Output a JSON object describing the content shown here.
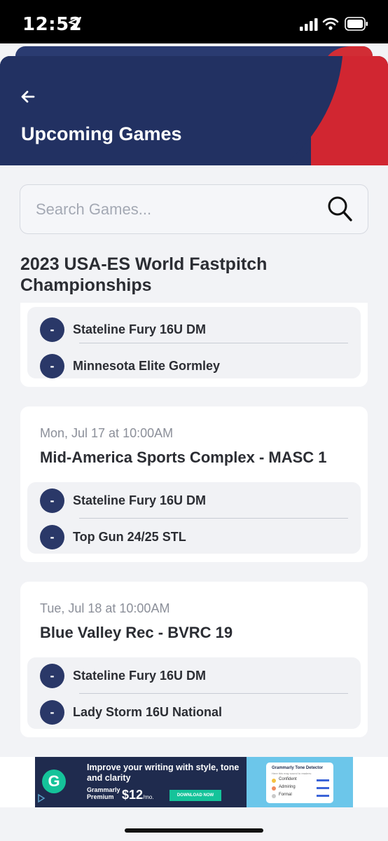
{
  "status_bar": {
    "time": "12:52"
  },
  "header": {
    "title": "Upcoming Games",
    "back_icon": "arrow-left-icon"
  },
  "search": {
    "placeholder": "Search Games...",
    "value": ""
  },
  "event": {
    "title": "2023 USA-ES World Fastpitch Championships"
  },
  "games": [
    {
      "date": "",
      "venue": "",
      "teams": [
        {
          "badge": "-",
          "name": "Stateline Fury 16U DM"
        },
        {
          "badge": "-",
          "name": "Minnesota Elite Gormley"
        }
      ]
    },
    {
      "date": "Mon, Jul 17 at 10:00AM",
      "venue": "Mid-America Sports Complex - MASC 1",
      "teams": [
        {
          "badge": "-",
          "name": "Stateline Fury 16U DM"
        },
        {
          "badge": "-",
          "name": "Top Gun 24/25 STL"
        }
      ]
    },
    {
      "date": "Tue, Jul 18 at 10:00AM",
      "venue": "Blue Valley Rec - BVRC 19",
      "teams": [
        {
          "badge": "-",
          "name": "Stateline Fury 16U DM"
        },
        {
          "badge": "-",
          "name": "Lady Storm 16U National"
        }
      ]
    }
  ],
  "ad": {
    "logo": "G",
    "headline": "Improve your writing with style, tone and clarity",
    "brand": "Grammarly Premium",
    "price": "$12",
    "price_unit": "/mo.",
    "cta": "DOWNLOAD NOW",
    "tone_title": "Grammarly Tone Detector",
    "tone_sub": "Here this may sound to readers:",
    "tones": [
      "Confident",
      "Admiring",
      "Formal"
    ]
  },
  "colors": {
    "header_blue": "#223162",
    "header_red": "#d12631",
    "badge_blue": "#2a3868",
    "ad_green": "#15c39a"
  }
}
